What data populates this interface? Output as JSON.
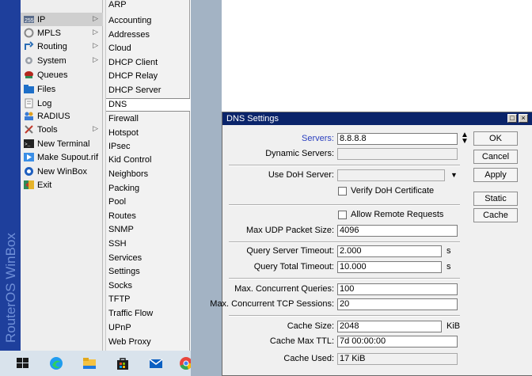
{
  "brand": {
    "text": "RouterOS WinBox"
  },
  "main_menu": {
    "items": [
      {
        "label": "IP",
        "icon": "ip-icon",
        "has_submenu": true,
        "selected": true
      },
      {
        "label": "MPLS",
        "icon": "mpls-icon",
        "has_submenu": true
      },
      {
        "label": "Routing",
        "icon": "routing-icon",
        "has_submenu": true
      },
      {
        "label": "System",
        "icon": "system-gear-icon",
        "has_submenu": true
      },
      {
        "label": "Queues",
        "icon": "queues-icon",
        "has_submenu": false
      },
      {
        "label": "Files",
        "icon": "folder-icon",
        "has_submenu": false
      },
      {
        "label": "Log",
        "icon": "log-icon",
        "has_submenu": false
      },
      {
        "label": "RADIUS",
        "icon": "radius-icon",
        "has_submenu": false
      },
      {
        "label": "Tools",
        "icon": "tools-icon",
        "has_submenu": true
      },
      {
        "label": "New Terminal",
        "icon": "terminal-icon",
        "has_submenu": false
      },
      {
        "label": "Make Supout.rif",
        "icon": "supout-icon",
        "has_submenu": false
      },
      {
        "label": "New WinBox",
        "icon": "winbox-icon",
        "has_submenu": false
      },
      {
        "label": "Exit",
        "icon": "exit-icon",
        "has_submenu": false
      }
    ]
  },
  "ip_submenu": {
    "items": [
      "ARP",
      "Accounting",
      "Addresses",
      "Cloud",
      "DHCP Client",
      "DHCP Relay",
      "DHCP Server",
      "DNS",
      "Firewall",
      "Hotspot",
      "IPsec",
      "Kid Control",
      "Neighbors",
      "Packing",
      "Pool",
      "Routes",
      "SNMP",
      "SSH",
      "Services",
      "Settings",
      "Socks",
      "TFTP",
      "Traffic Flow",
      "UPnP",
      "Web Proxy"
    ],
    "selected": "DNS"
  },
  "taskbar": {
    "icons": [
      "windows-start-icon",
      "edge-browser-icon",
      "file-explorer-icon",
      "store-icon",
      "mail-icon",
      "chrome-icon"
    ]
  },
  "dns_window": {
    "title": "DNS Settings",
    "title_buttons": {
      "restore": "□",
      "close": "×"
    },
    "fields": {
      "servers_label": "Servers:",
      "servers_value": "8.8.8.8",
      "dynamic_servers_label": "Dynamic Servers:",
      "dynamic_servers_value": "",
      "use_doh_label": "Use DoH Server:",
      "use_doh_value": "",
      "verify_doh_label": "Verify DoH Certificate",
      "allow_remote_label": "Allow Remote Requests",
      "max_udp_label": "Max UDP Packet Size:",
      "max_udp_value": "4096",
      "query_server_timeout_label": "Query Server Timeout:",
      "query_server_timeout_value": "2.000",
      "query_server_timeout_unit": "s",
      "query_total_timeout_label": "Query Total Timeout:",
      "query_total_timeout_value": "10.000",
      "query_total_timeout_unit": "s",
      "max_concurrent_queries_label": "Max. Concurrent Queries:",
      "max_concurrent_queries_value": "100",
      "max_concurrent_tcp_label": "Max. Concurrent TCP Sessions:",
      "max_concurrent_tcp_value": "20",
      "cache_size_label": "Cache Size:",
      "cache_size_value": "2048",
      "cache_size_unit": "KiB",
      "cache_max_ttl_label": "Cache Max TTL:",
      "cache_max_ttl_value": "7d 00:00:00",
      "cache_used_label": "Cache Used:",
      "cache_used_value": "17 KiB"
    },
    "buttons": {
      "ok": "OK",
      "cancel": "Cancel",
      "apply": "Apply",
      "static": "Static",
      "cache": "Cache"
    }
  }
}
